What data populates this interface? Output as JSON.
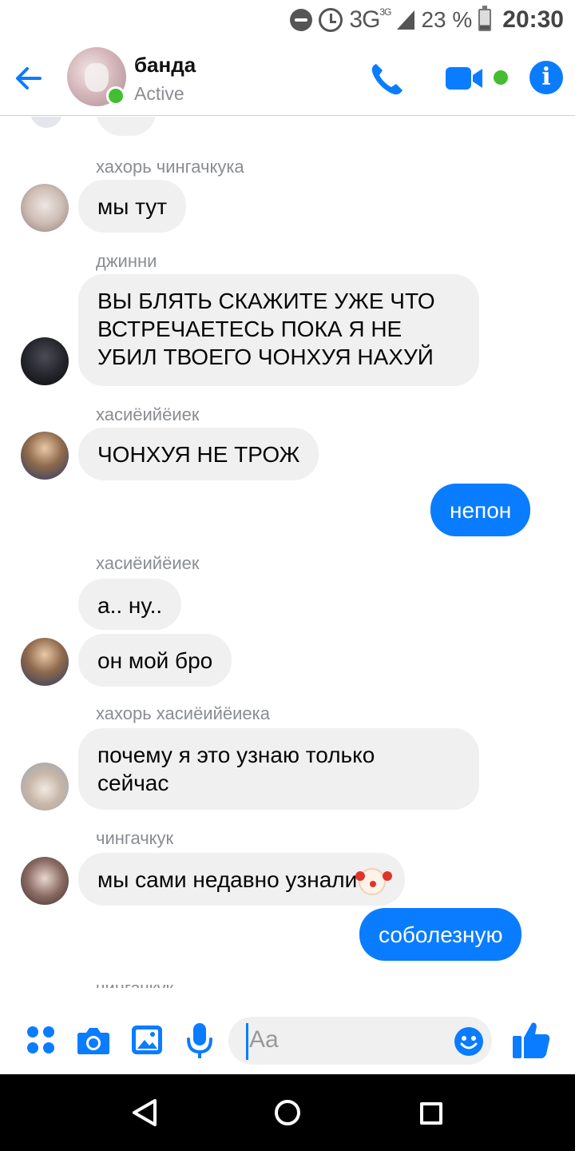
{
  "status_bar": {
    "network": "3G",
    "network_small": "3G",
    "battery": "23 %",
    "time": "20:30"
  },
  "header": {
    "title": "банда",
    "status": "Active"
  },
  "messages": [
    {
      "sender": "хахорь чингачкука",
      "text": "мы тут"
    },
    {
      "sender": "джинни",
      "lines": [
        "ВЫ БЛЯТЬ СКАЖИТЕ УЖЕ ЧТО",
        "ВСТРЕЧАЕТЕСЬ ПОКА Я НЕ",
        "УБИЛ ТВОЕГО ЧОНХУЯ НАХУЙ"
      ]
    },
    {
      "sender": "хасиёийёиек",
      "text": "ЧОНХУЯ НЕ ТРОЖ"
    },
    {
      "outgoing": true,
      "text": "непон"
    },
    {
      "sender": "хасиёийёиек",
      "text": "а.. ну.."
    },
    {
      "text": "он мой бро"
    },
    {
      "sender": "хахорь хасиёийёиека",
      "lines": [
        "почему я это узнаю только",
        "сейчас"
      ]
    },
    {
      "sender": "чингачкук",
      "text": "мы сами недавно узнали",
      "emoji": "clown-face-icon"
    },
    {
      "outgoing": true,
      "text": "соболезную"
    },
    {
      "sender": "чингачкук"
    }
  ],
  "composer": {
    "placeholder": "Aa"
  },
  "colors": {
    "accent": "#0a7cff",
    "online": "#44bd32",
    "bubble_in": "#f0f0f0"
  }
}
